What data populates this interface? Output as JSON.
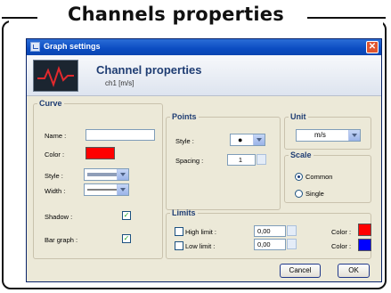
{
  "banner": {
    "title": "Channels properties"
  },
  "window": {
    "title": "Graph settings",
    "header_title": "Channel properties",
    "header_subtitle": "ch1  [m/s]"
  },
  "curve": {
    "legend": "Curve",
    "name_label": "Name :",
    "name_value": "",
    "color_label": "Color :",
    "color_value": "#ff0000",
    "style_label": "Style :",
    "width_label": "Width :",
    "shadow_label": "Shadow :",
    "shadow_checked": true,
    "bargraph_label": "Bar graph :",
    "bargraph_checked": true
  },
  "points": {
    "legend": "Points",
    "style_label": "Style :",
    "style_value": "●",
    "spacing_label": "Spacing :",
    "spacing_value": "1"
  },
  "unit": {
    "legend": "Unit",
    "value": "m/s"
  },
  "scale": {
    "legend": "Scale",
    "options": [
      "Common",
      "Single"
    ],
    "selected": "Common"
  },
  "limits": {
    "legend": "Limits",
    "high_label": "High limit :",
    "high_value": "0,00",
    "high_color": "#ff0000",
    "low_label": "Low limit :",
    "low_value": "0,00",
    "low_color": "#0000ff",
    "color_label": "Color :"
  },
  "buttons": {
    "cancel": "Cancel",
    "ok": "OK"
  },
  "colors": {
    "accent": "#1f3d73",
    "title_bar": "#0b4cc2"
  }
}
